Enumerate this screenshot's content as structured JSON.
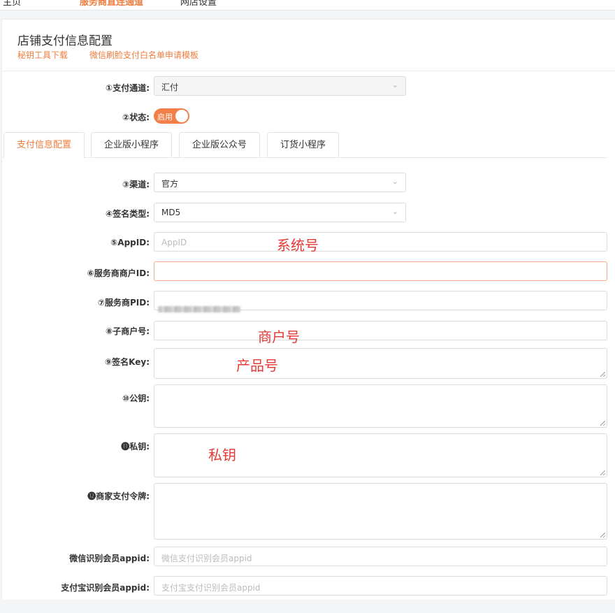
{
  "topnav": {
    "items": [
      "主页",
      "服务商直连通道",
      "网店设置"
    ],
    "active_index": 1
  },
  "card": {
    "title": "店铺支付信息配置",
    "links": [
      "秘钥工具下载",
      "微信刷脸支付白名单申请模板"
    ]
  },
  "form": {
    "channel": {
      "label": "①支付通道:",
      "value": "汇付"
    },
    "status": {
      "label": "②状态:",
      "toggle_text": "启用",
      "on": true
    },
    "tabs": [
      "支付信息配置",
      "企业版小程序",
      "企业版公众号",
      "订货小程序"
    ],
    "active_tab": 0,
    "qudao": {
      "label": "③渠道:",
      "value": "官方"
    },
    "sign_type": {
      "label": "④签名类型:",
      "value": "MD5"
    },
    "appid": {
      "label": "⑤AppID:",
      "placeholder": "AppID"
    },
    "sp_mchid": {
      "label": "⑥服务商商户ID:"
    },
    "sp_pid": {
      "label": "⑦服务商PID:"
    },
    "sub_mchid": {
      "label": "⑧子商户号:"
    },
    "sign_key": {
      "label": "⑨签名Key:"
    },
    "public_key": {
      "label": "⑩公钥:"
    },
    "private_key": {
      "label": "⓫私钥:"
    },
    "merchant_token": {
      "label": "⓬商家支付令牌:"
    },
    "wx_member_appid": {
      "label": "微信识别会员appid:",
      "placeholder": "微信支付识别会员appid"
    },
    "ali_member_appid": {
      "label": "支付宝识别会员appid:",
      "placeholder": "支付宝支付识别会员appid"
    }
  },
  "annotations": [
    "系统号",
    "商户号",
    "产品号",
    "私钥"
  ],
  "icons": {
    "select_arrow": "chevron-down-icon",
    "resize": "resize-handle-icon"
  },
  "colors": {
    "accent": "#f07c3e",
    "toggle": "#f27f48",
    "annotation": "#e53935"
  }
}
